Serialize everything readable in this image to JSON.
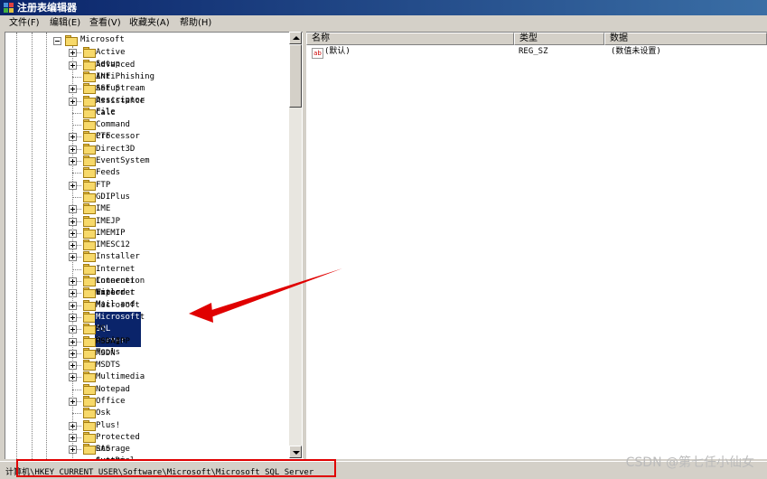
{
  "window": {
    "title": "注册表编辑器"
  },
  "menu": [
    "文件(F)",
    "编辑(E)",
    "查看(V)",
    "收藏夹(A)",
    "帮助(H)"
  ],
  "tree": {
    "parent": "Microsoft",
    "items": [
      {
        "label": "Active Setup",
        "expandable": true
      },
      {
        "label": "Advanced INF Setup",
        "expandable": true
      },
      {
        "label": "AntiPhishing",
        "expandable": false
      },
      {
        "label": "ASF Stream Descriptor File",
        "expandable": true
      },
      {
        "label": "Assistance",
        "expandable": true
      },
      {
        "label": "Calc",
        "expandable": false
      },
      {
        "label": "Command Processor",
        "expandable": false
      },
      {
        "label": "CTF",
        "expandable": true
      },
      {
        "label": "Direct3D",
        "expandable": true
      },
      {
        "label": "EventSystem",
        "expandable": true
      },
      {
        "label": "Feeds",
        "expandable": false
      },
      {
        "label": "FTP",
        "expandable": true
      },
      {
        "label": "GDIPlus",
        "expandable": false
      },
      {
        "label": "IME",
        "expandable": true
      },
      {
        "label": "IMEJP",
        "expandable": true
      },
      {
        "label": "IMEMIP",
        "expandable": true
      },
      {
        "label": "IMESC12",
        "expandable": true
      },
      {
        "label": "Installer",
        "expandable": true
      },
      {
        "label": "Internet Connection Wizard",
        "expandable": false
      },
      {
        "label": "Internet Explorer",
        "expandable": true
      },
      {
        "label": "Internet Mail and News",
        "expandable": true
      },
      {
        "label": "Microsoft Management Consol",
        "expandable": true
      },
      {
        "label": "Microsoft SQL Server",
        "expandable": true,
        "selected": true
      },
      {
        "label": "MS Design Tools",
        "expandable": true
      },
      {
        "label": "MSDAIPP",
        "expandable": true
      },
      {
        "label": "MSDN",
        "expandable": true
      },
      {
        "label": "MSDTS",
        "expandable": true
      },
      {
        "label": "Multimedia",
        "expandable": true
      },
      {
        "label": "Notepad",
        "expandable": false
      },
      {
        "label": "Office",
        "expandable": true
      },
      {
        "label": "Osk",
        "expandable": false
      },
      {
        "label": "Plus!",
        "expandable": true
      },
      {
        "label": "Protected Storage System Provider",
        "expandable": true
      },
      {
        "label": "RAS AutoDial",
        "expandable": true
      }
    ]
  },
  "list": {
    "columns": [
      "名称",
      "类型",
      "数据"
    ],
    "rows": [
      {
        "name": "(默认)",
        "type": "REG_SZ",
        "data": "(数值未设置)"
      }
    ]
  },
  "status": {
    "path": "计算机\\HKEY_CURRENT_USER\\Software\\Microsoft\\Microsoft SQL Server"
  },
  "watermark": "CSDN @第七任小仙女",
  "colors": {
    "selection": "#0a246a",
    "annotation": "#e00000",
    "folder": "#f7d96a"
  }
}
